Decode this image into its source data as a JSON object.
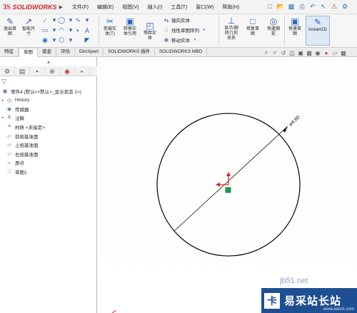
{
  "app": {
    "logo_prefix": "3S",
    "logo_name": "SOLIDWORKS",
    "logo_arrow": "▶"
  },
  "menu": [
    "文件(F)",
    "编辑(E)",
    "视图(V)",
    "插入(I)",
    "工具(T)",
    "窗口(W)",
    "帮助(H)"
  ],
  "quick_access": [
    "new-icon",
    "open-icon",
    "save-icon",
    "print-icon",
    "undo-icon",
    "select-icon",
    "rebuild-icon",
    "options-icon"
  ],
  "ribbon": {
    "exit_sketch": "退出草\n图",
    "smart_dim": "智能尺\n寸",
    "trim": "剪裁实\n体(T)",
    "convert": "转换实\n体引用",
    "offset": "等距实\n体",
    "mirror": "镜向实体",
    "linear_pattern": "线性草图阵列",
    "move": "移动实体",
    "relations": "显示/删\n除几何\n关系",
    "repair": "修复草\n图",
    "quick_snap": "快速捕\n捉",
    "rapid_sketch": "快速草\n图",
    "instant2d": "Instant2D"
  },
  "tabs": [
    "特征",
    "草图",
    "钣金",
    "评估",
    "DimXpert",
    "SOLIDWORKS 插件",
    "SOLIDWORKS MBD"
  ],
  "tree": {
    "part": "零件4 (默认<<默认>_显示状态 1>)",
    "items": [
      "History",
      "传感器",
      "注解",
      "材质 <未指定>",
      "前视基准面",
      "上视基准面",
      "右视基准面",
      "原点",
      "草图1"
    ]
  },
  "dimension": {
    "text": "⌀4.80",
    "value": 4.8
  },
  "watermark": {
    "mark": "卡",
    "text": "易采站长站",
    "url": "www.easck.com",
    "ghost": "jb51.net"
  },
  "colors": {
    "brand_red": "#d2232a",
    "accent_blue": "#2b62b8",
    "origin_red": "#e02020",
    "point_green": "#1aa34a"
  }
}
